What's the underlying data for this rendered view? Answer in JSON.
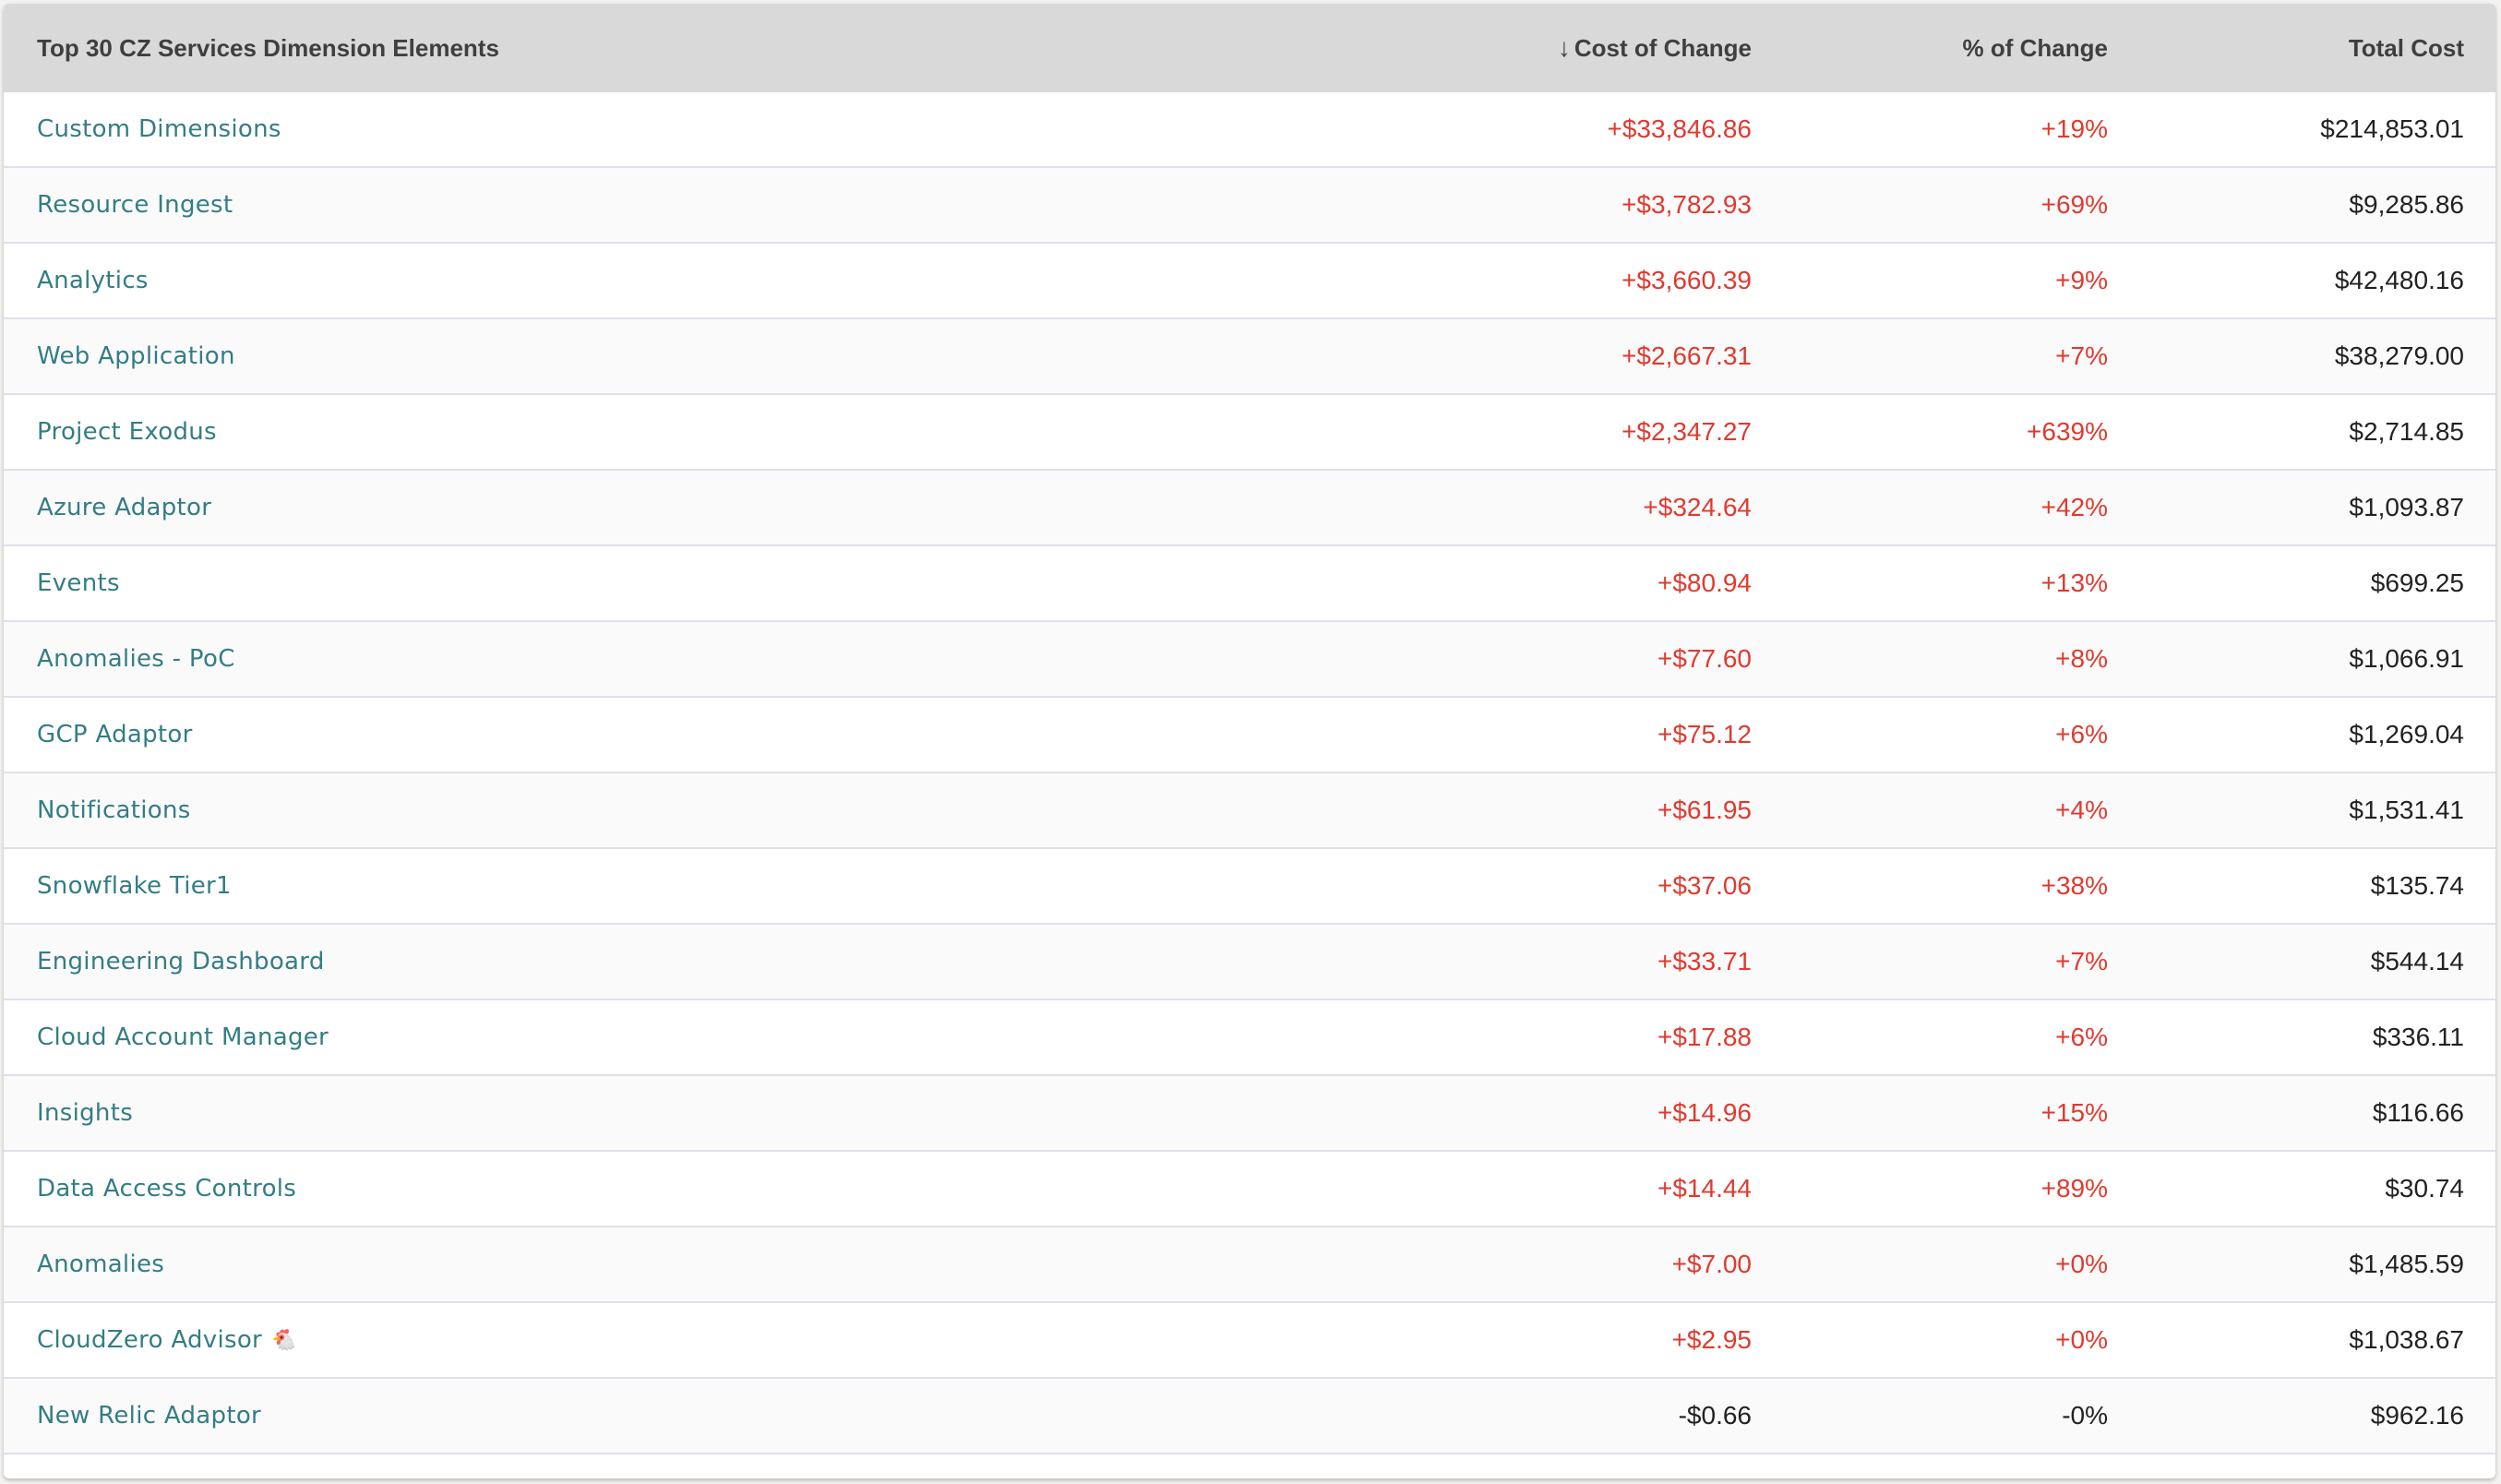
{
  "table": {
    "title": "Top 30 CZ Services Dimension Elements",
    "columns": {
      "name": "Top 30 CZ Services Dimension Elements",
      "cost_of_change": "Cost of Change",
      "pct_of_change": "% of Change",
      "total_cost": "Total Cost"
    },
    "sort": {
      "column": "cost_of_change",
      "direction": "descending",
      "icon": "arrow-down-icon",
      "glyph": "↓"
    },
    "colors": {
      "link": "#347d85",
      "increase": "#e03a2f",
      "neutral": "#222222",
      "header_bg": "#d9d9d9"
    },
    "rows": [
      {
        "name": "Custom Dimensions",
        "emoji": "",
        "cost_of_change": "+$33,846.86",
        "pct_of_change": "+19%",
        "total_cost": "$214,853.01",
        "trend": "increase"
      },
      {
        "name": "Resource Ingest",
        "emoji": "",
        "cost_of_change": "+$3,782.93",
        "pct_of_change": "+69%",
        "total_cost": "$9,285.86",
        "trend": "increase"
      },
      {
        "name": "Analytics",
        "emoji": "",
        "cost_of_change": "+$3,660.39",
        "pct_of_change": "+9%",
        "total_cost": "$42,480.16",
        "trend": "increase"
      },
      {
        "name": "Web Application",
        "emoji": "",
        "cost_of_change": "+$2,667.31",
        "pct_of_change": "+7%",
        "total_cost": "$38,279.00",
        "trend": "increase"
      },
      {
        "name": "Project Exodus",
        "emoji": "",
        "cost_of_change": "+$2,347.27",
        "pct_of_change": "+639%",
        "total_cost": "$2,714.85",
        "trend": "increase"
      },
      {
        "name": "Azure Adaptor",
        "emoji": "",
        "cost_of_change": "+$324.64",
        "pct_of_change": "+42%",
        "total_cost": "$1,093.87",
        "trend": "increase"
      },
      {
        "name": "Events",
        "emoji": "",
        "cost_of_change": "+$80.94",
        "pct_of_change": "+13%",
        "total_cost": "$699.25",
        "trend": "increase"
      },
      {
        "name": "Anomalies - PoC",
        "emoji": "",
        "cost_of_change": "+$77.60",
        "pct_of_change": "+8%",
        "total_cost": "$1,066.91",
        "trend": "increase"
      },
      {
        "name": "GCP Adaptor",
        "emoji": "",
        "cost_of_change": "+$75.12",
        "pct_of_change": "+6%",
        "total_cost": "$1,269.04",
        "trend": "increase"
      },
      {
        "name": "Notifications",
        "emoji": "",
        "cost_of_change": "+$61.95",
        "pct_of_change": "+4%",
        "total_cost": "$1,531.41",
        "trend": "increase"
      },
      {
        "name": "Snowflake Tier1",
        "emoji": "",
        "cost_of_change": "+$37.06",
        "pct_of_change": "+38%",
        "total_cost": "$135.74",
        "trend": "increase"
      },
      {
        "name": "Engineering Dashboard",
        "emoji": "",
        "cost_of_change": "+$33.71",
        "pct_of_change": "+7%",
        "total_cost": "$544.14",
        "trend": "increase"
      },
      {
        "name": "Cloud Account Manager",
        "emoji": "",
        "cost_of_change": "+$17.88",
        "pct_of_change": "+6%",
        "total_cost": "$336.11",
        "trend": "increase"
      },
      {
        "name": "Insights",
        "emoji": "",
        "cost_of_change": "+$14.96",
        "pct_of_change": "+15%",
        "total_cost": "$116.66",
        "trend": "increase"
      },
      {
        "name": "Data Access Controls",
        "emoji": "",
        "cost_of_change": "+$14.44",
        "pct_of_change": "+89%",
        "total_cost": "$30.74",
        "trend": "increase"
      },
      {
        "name": "Anomalies",
        "emoji": "",
        "cost_of_change": "+$7.00",
        "pct_of_change": "+0%",
        "total_cost": "$1,485.59",
        "trend": "increase"
      },
      {
        "name": "CloudZero Advisor",
        "emoji": "🐔",
        "cost_of_change": "+$2.95",
        "pct_of_change": "+0%",
        "total_cost": "$1,038.67",
        "trend": "increase"
      },
      {
        "name": "New Relic Adaptor",
        "emoji": "",
        "cost_of_change": "-$0.66",
        "pct_of_change": "-0%",
        "total_cost": "$962.16",
        "trend": "decrease"
      }
    ]
  }
}
